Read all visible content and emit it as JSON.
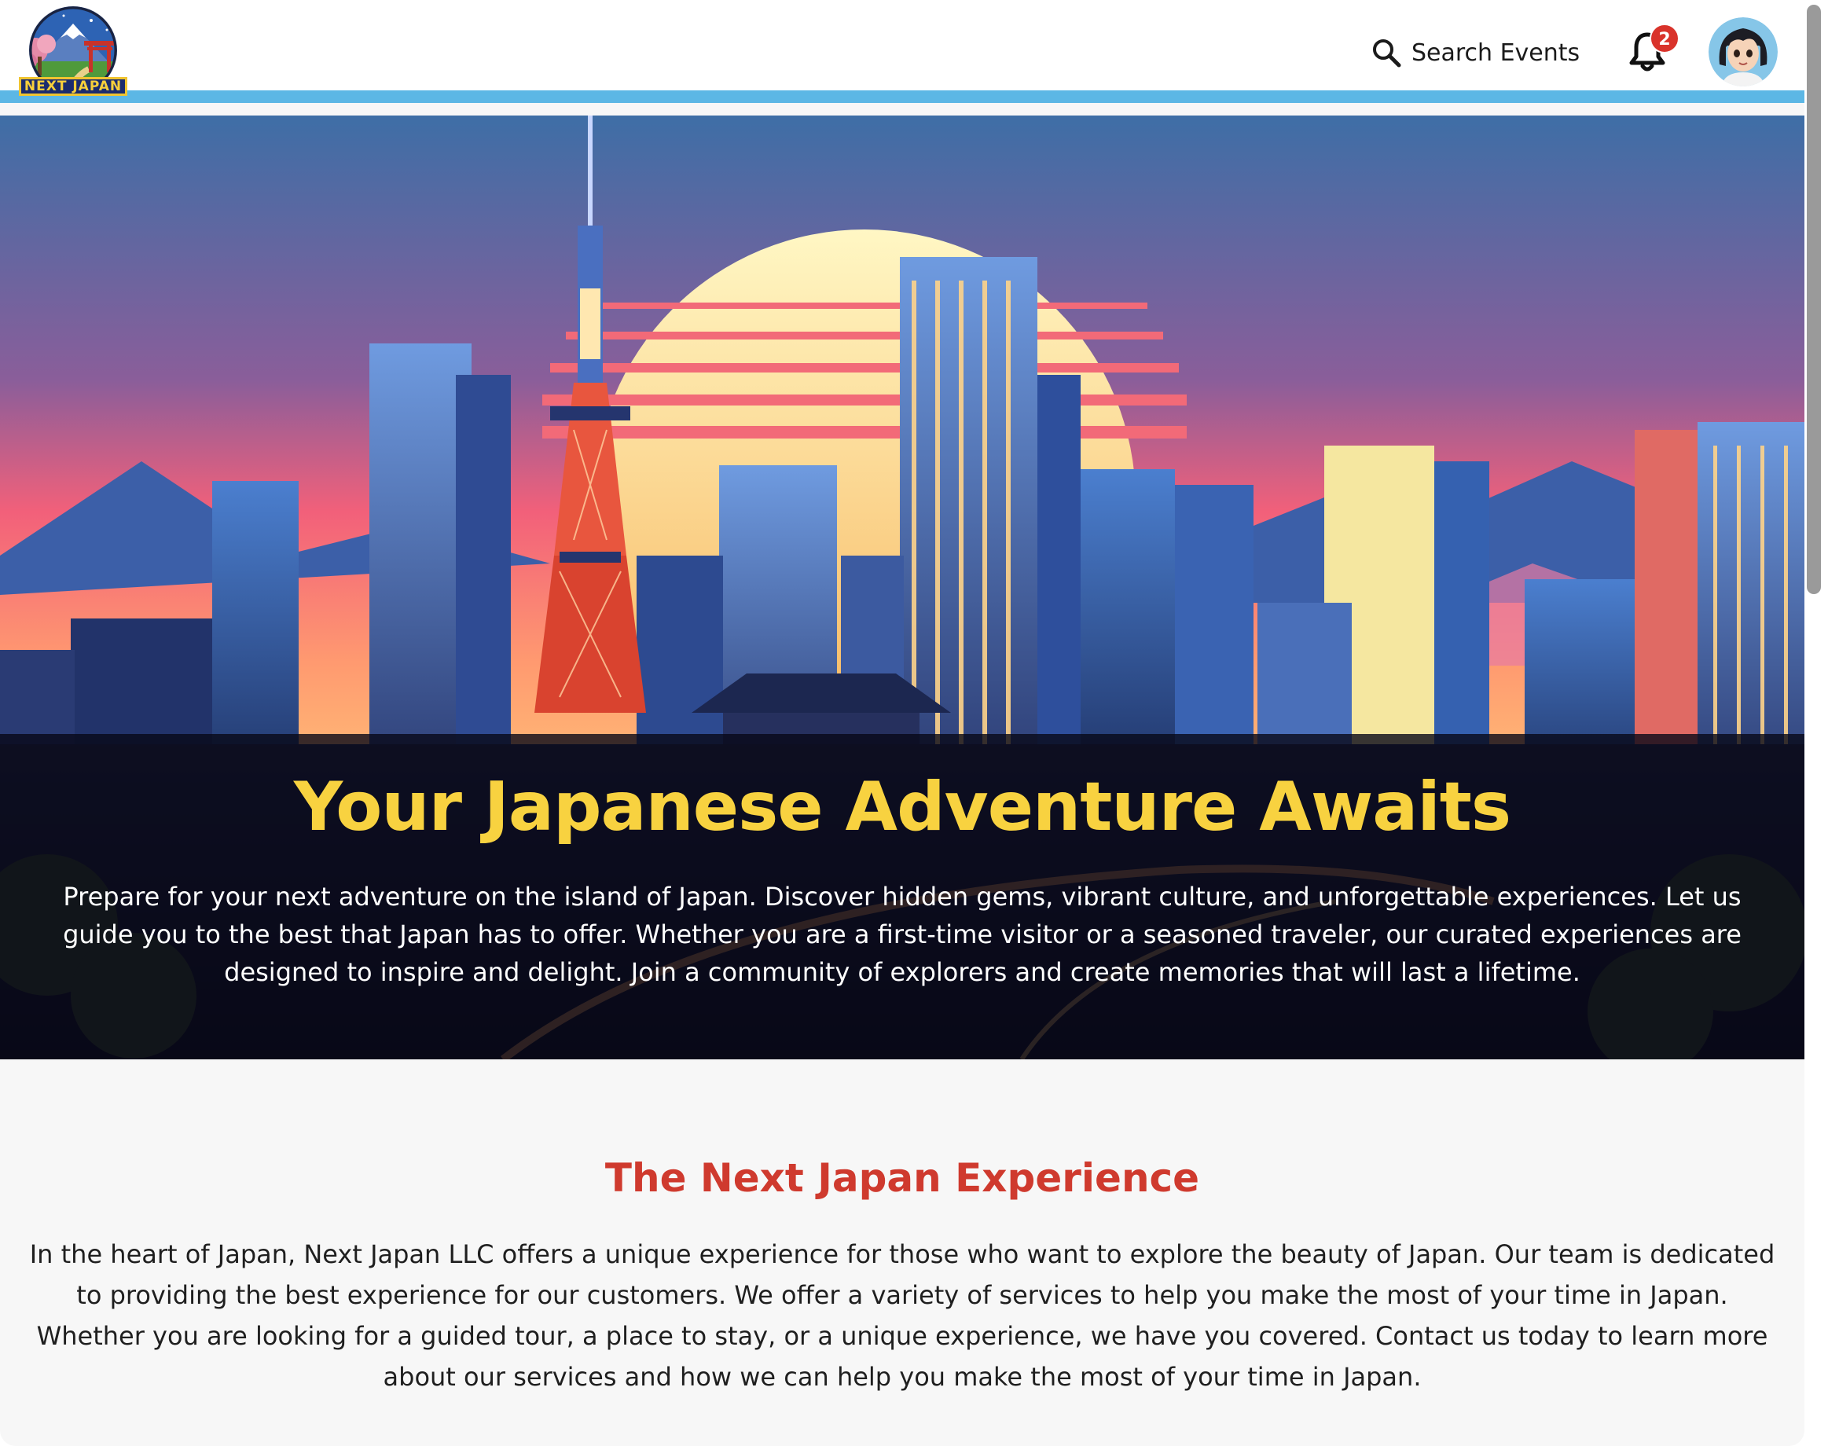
{
  "header": {
    "logo_text": "NEXT JAPAN",
    "search_label": "Search Events",
    "notification_count": "2"
  },
  "hero": {
    "title": "Your Japanese Adventure Awaits",
    "text": "Prepare for your next adventure on the island of Japan. Discover hidden gems, vibrant culture, and unforgettable experiences. Let us guide you to the best that Japan has to offer. Whether you are a first-time visitor or a seasoned traveler, our curated experiences are designed to inspire and delight. Join a community of explorers and create memories that will last a lifetime."
  },
  "about": {
    "title": "The Next Japan Experience",
    "text": "In the heart of Japan, Next Japan LLC offers a unique experience for those who want to explore the beauty of Japan. Our team is dedicated to providing the best experience for our customers. We offer a variety of services to help you make the most of your time in Japan. Whether you are looking for a guided tour, a place to stay, or a unique experience, we have you covered. Contact us today to learn more about our services and how we can help you make the most of your time in Japan."
  },
  "colors": {
    "accent_bar": "#5cb7e5",
    "hero_title": "#f8d240",
    "section_title": "#cf3a2e",
    "badge": "#d9332b"
  },
  "icons": [
    "search-icon",
    "bell-icon",
    "avatar"
  ]
}
